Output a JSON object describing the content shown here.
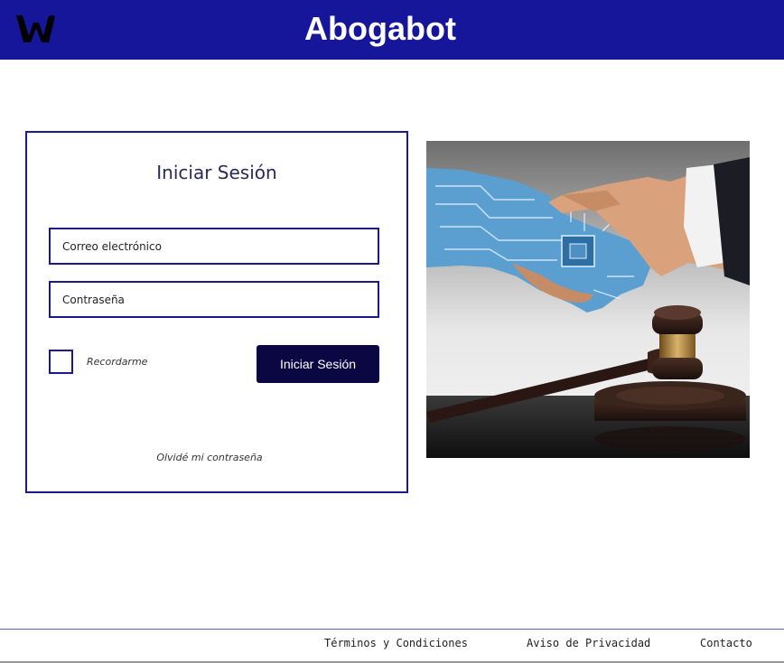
{
  "header": {
    "title": "Abogabot",
    "logo_icon": "w-logo-icon"
  },
  "login": {
    "title": "Iniciar Sesión",
    "email_placeholder": "Correo electrónico",
    "password_placeholder": "Contraseña",
    "remember_label": "Recordarme",
    "submit_label": "Iniciar Sesión",
    "forgot_label": "Olvidé mi contraseña"
  },
  "hero": {
    "icons": [
      "handshake-robot-human-icon",
      "gavel-icon"
    ]
  },
  "footer": {
    "terms": "Términos y Condiciones",
    "privacy": "Aviso de Privacidad",
    "contact": "Contacto"
  },
  "colors": {
    "header_bg": "#15169a",
    "border": "#1a1a8c",
    "button_bg": "#0a0742"
  }
}
